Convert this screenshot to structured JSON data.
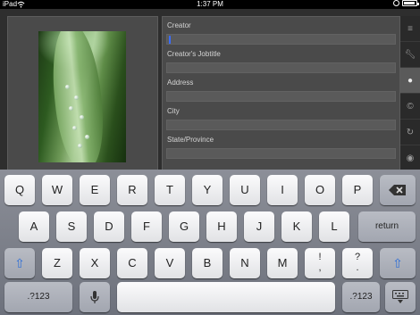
{
  "status": {
    "carrier": "iPad",
    "time": "1:37 PM"
  },
  "form": {
    "fields": [
      {
        "label": "Creator",
        "value": ""
      },
      {
        "label": "Creator's Jobtitle",
        "value": ""
      },
      {
        "label": "Address",
        "value": ""
      },
      {
        "label": "City",
        "value": ""
      },
      {
        "label": "State/Province",
        "value": ""
      }
    ]
  },
  "tabs": [
    "list-icon",
    "wrench-icon",
    "person-icon",
    "copyright-icon",
    "refresh-icon",
    "camera-icon"
  ],
  "keyboard": {
    "row1": [
      "Q",
      "W",
      "E",
      "R",
      "T",
      "Y",
      "U",
      "I",
      "O",
      "P"
    ],
    "row2": [
      "A",
      "S",
      "D",
      "F",
      "G",
      "H",
      "J",
      "K",
      "L"
    ],
    "row3": [
      "Z",
      "X",
      "C",
      "V",
      "B",
      "N",
      "M"
    ],
    "return_label": "return",
    "numbers_label": ".?123",
    "punct1_top": "!",
    "punct1_bottom": ",",
    "punct2_top": "?",
    "punct2_bottom": "."
  }
}
